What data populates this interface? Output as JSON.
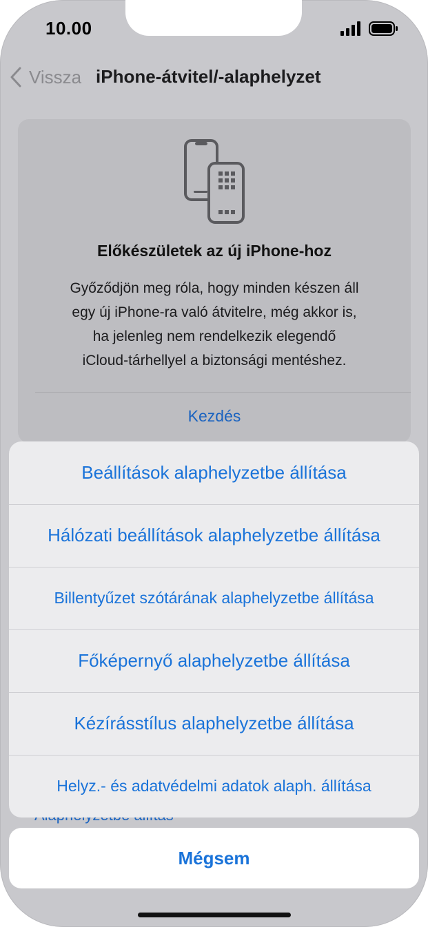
{
  "status_bar": {
    "time": "10.00"
  },
  "nav": {
    "back_label": "Vissza",
    "title": "iPhone-átvitel/-alaphelyzet"
  },
  "card": {
    "title": "Előkészületek az új iPhone-hoz",
    "body": "Győződjön meg róla, hogy minden készen áll\negy új iPhone-ra való átvitelre, még akkor is,\nha jelenleg nem rendelkezik elegendő\niCloud-tárhellyel a biztonsági mentéshez.",
    "link": "Kezdés"
  },
  "behind_text": "Alaphelyzetbe állítás",
  "action_sheet": {
    "items": [
      {
        "label": "Beállítások alaphelyzetbe állítása"
      },
      {
        "label": "Hálózati beállítások alaphelyzetbe állítása"
      },
      {
        "label": "Billentyűzet szótárának alaphelyzetbe állítása"
      },
      {
        "label": "Főképernyő alaphelyzetbe állítása"
      },
      {
        "label": "Kézírásstílus alaphelyzetbe állítása"
      },
      {
        "label": "Helyz.- és adatvédelmi adatok alaph. állítása"
      }
    ],
    "cancel": "Mégsem"
  },
  "icons": {
    "back": "chevron-left-icon",
    "signal": "cellular-signal-icon",
    "battery": "battery-icon",
    "devices": "two-iphones-icon"
  },
  "colors": {
    "accent": "#1a73d9",
    "dim_background": "#c8c8cc"
  }
}
